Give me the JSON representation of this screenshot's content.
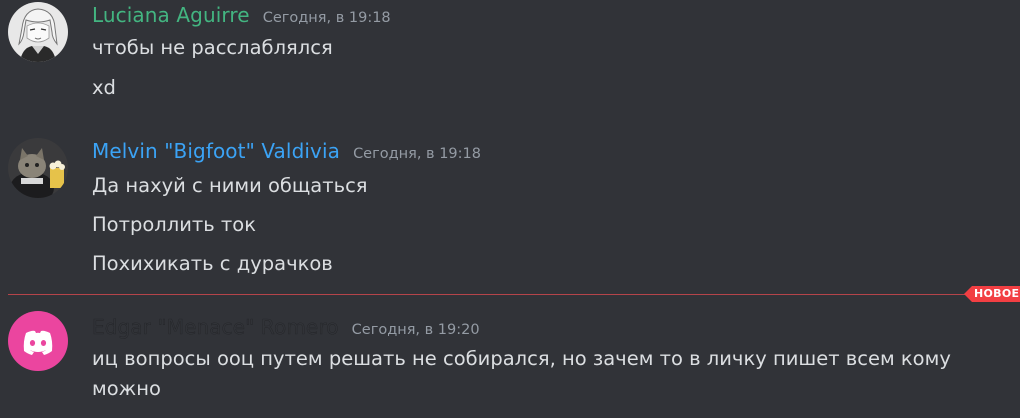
{
  "colors": {
    "background": "#313338",
    "message_text": "#dbdee1",
    "timestamp": "#949ba4",
    "user1_name": "#43b581",
    "user2_name": "#3ba3f5",
    "user3_name": "#313338",
    "new_divider": "#f23f43"
  },
  "messages": [
    {
      "author": "Luciana Aguirre",
      "timestamp": "Сегодня, в 19:18",
      "avatar_icon": "anime-character-avatar-icon",
      "lines": [
        "чтобы не расслаблялся",
        "xd"
      ]
    },
    {
      "author": "Melvin \"Bigfoot\" Valdivia",
      "timestamp": "Сегодня, в 19:18",
      "avatar_icon": "cat-with-popcorn-avatar-icon",
      "lines": [
        "Да нахуй с ними общаться",
        "Потроллить ток",
        "Похихикать с дурачков"
      ]
    },
    {
      "author": "Edgar \"Menace\" Romero",
      "timestamp": "Сегодня, в 19:20",
      "avatar_icon": "discord-default-avatar-icon",
      "lines": [
        "иц вопросы оoц путем решать не собирался, но зачем то в личку пишет всем кому можно"
      ]
    }
  ],
  "new_messages_badge": "НОВОЕ"
}
